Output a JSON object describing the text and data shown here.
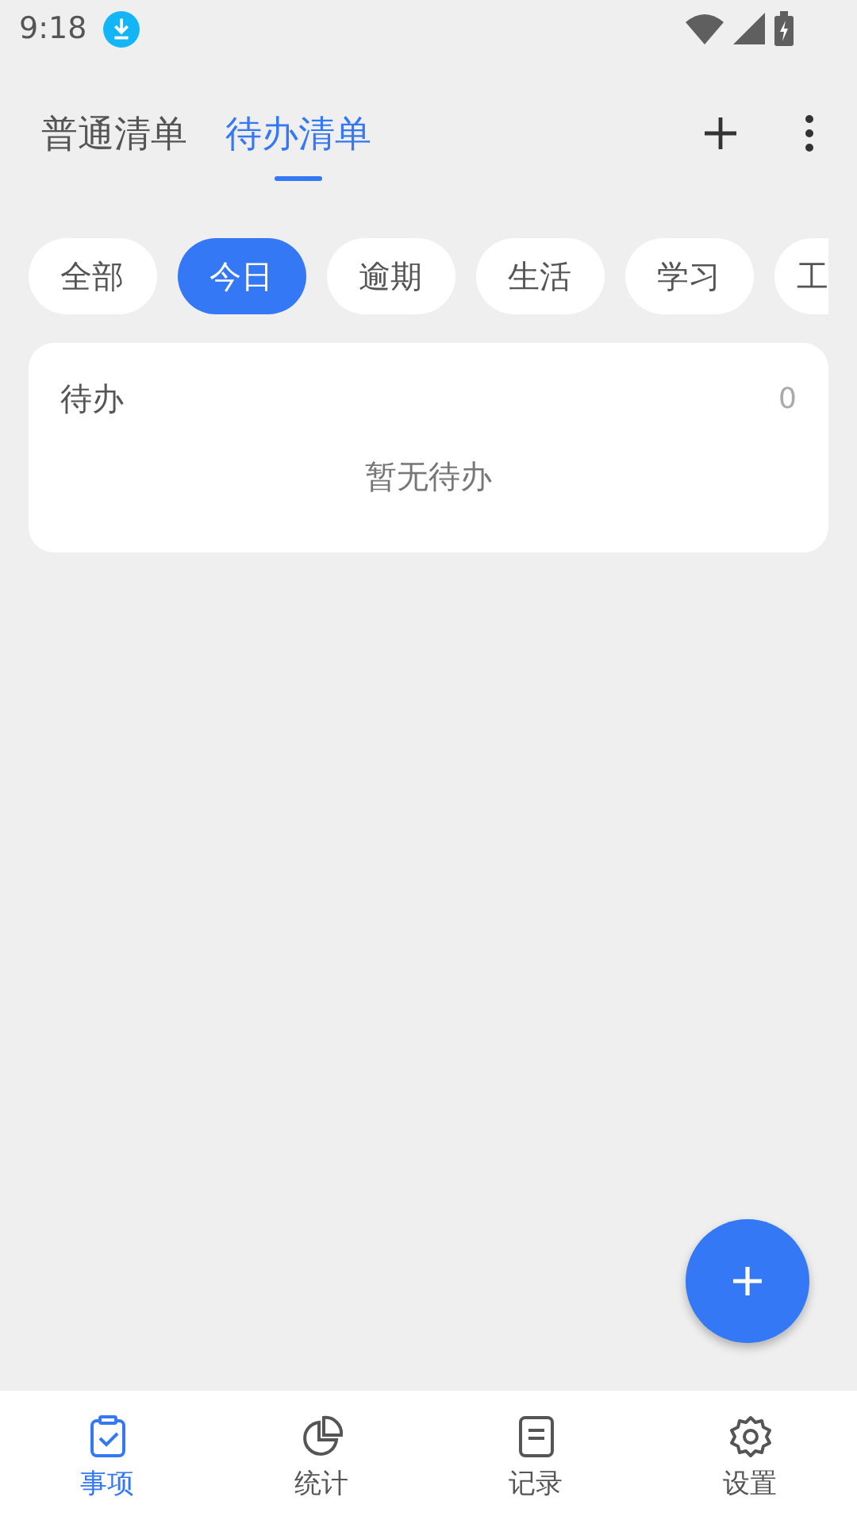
{
  "status_bar": {
    "time": "9:18"
  },
  "header": {
    "tabs": [
      {
        "label": "普通清单",
        "selected": false
      },
      {
        "label": "待办清单",
        "selected": true
      }
    ]
  },
  "filters": [
    {
      "label": "全部",
      "selected": false
    },
    {
      "label": "今日",
      "selected": true
    },
    {
      "label": "逾期",
      "selected": false
    },
    {
      "label": "生活",
      "selected": false
    },
    {
      "label": "学习",
      "selected": false
    },
    {
      "label": "工",
      "selected": false
    }
  ],
  "todo_card": {
    "title": "待办",
    "count": "0",
    "empty_text": "暂无待办"
  },
  "bottom_nav": [
    {
      "label": "事项",
      "kind": "clipboard",
      "selected": true
    },
    {
      "label": "统计",
      "kind": "chart",
      "selected": false
    },
    {
      "label": "记录",
      "kind": "note",
      "selected": false
    },
    {
      "label": "设置",
      "kind": "gear",
      "selected": false
    }
  ]
}
